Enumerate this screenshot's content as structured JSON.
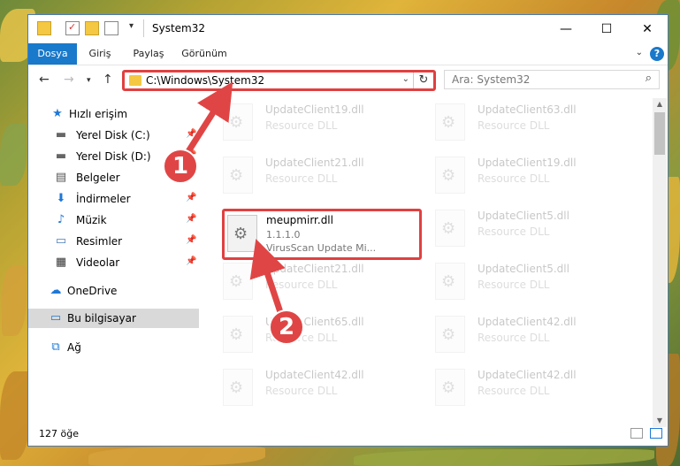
{
  "window": {
    "title": "System32",
    "controls": {
      "minimize": "—",
      "maximize": "☐",
      "close": "✕"
    }
  },
  "ribbon": {
    "tabs": [
      {
        "label": "Dosya",
        "active": true
      },
      {
        "label": "Giriş",
        "active": false
      },
      {
        "label": "Paylaş",
        "active": false
      },
      {
        "label": "Görünüm",
        "active": false
      }
    ],
    "help": "?"
  },
  "address": {
    "path": "C:\\Windows\\System32"
  },
  "search": {
    "placeholder": "Ara: System32"
  },
  "sidebar": {
    "items": [
      {
        "label": "Hızlı erişim",
        "icon": "star-icon"
      },
      {
        "label": "Yerel Disk (C:)",
        "icon": "drive-icon"
      },
      {
        "label": "Yerel Disk (D:)",
        "icon": "drive-icon"
      },
      {
        "label": "Belgeler",
        "icon": "documents-icon"
      },
      {
        "label": "İndirmeler",
        "icon": "download-icon"
      },
      {
        "label": "Müzik",
        "icon": "music-icon"
      },
      {
        "label": "Resimler",
        "icon": "pictures-icon"
      },
      {
        "label": "Videolar",
        "icon": "video-icon"
      },
      {
        "label": "OneDrive",
        "icon": "cloud-icon"
      },
      {
        "label": "Bu bilgisayar",
        "icon": "computer-icon",
        "selected": true
      },
      {
        "label": "Ağ",
        "icon": "network-icon"
      }
    ]
  },
  "files": {
    "left": [
      {
        "name": "UpdateClient19.dll",
        "desc": "Resource DLL"
      },
      {
        "name": "UpdateClient21.dll",
        "desc": "Resource DLL"
      },
      {
        "name": "UpdateClient21.dll",
        "desc": "Resource DLL"
      },
      {
        "name": "UpdateClient65.dll",
        "desc": "Resource DLL"
      },
      {
        "name": "UpdateClient42.dll",
        "desc": "Resource DLL"
      }
    ],
    "right": [
      {
        "name": "UpdateClient63.dll",
        "desc": "Resource DLL"
      },
      {
        "name": "UpdateClient19.dll",
        "desc": "Resource DLL"
      },
      {
        "name": "UpdateClient5.dll",
        "desc": "Resource DLL"
      },
      {
        "name": "UpdateClient5.dll",
        "desc": "Resource DLL"
      },
      {
        "name": "UpdateClient42.dll",
        "desc": "Resource DLL"
      },
      {
        "name": "UpdateClient42.dll",
        "desc": "Resource DLL"
      }
    ],
    "highlighted": {
      "name": "meupmirr.dll",
      "version": "1.1.1.0",
      "desc": "VirusScan Update Mi..."
    }
  },
  "status": {
    "count": "127 öğe"
  },
  "annotations": {
    "step1": "1",
    "step2": "2",
    "color": "#e04545"
  }
}
